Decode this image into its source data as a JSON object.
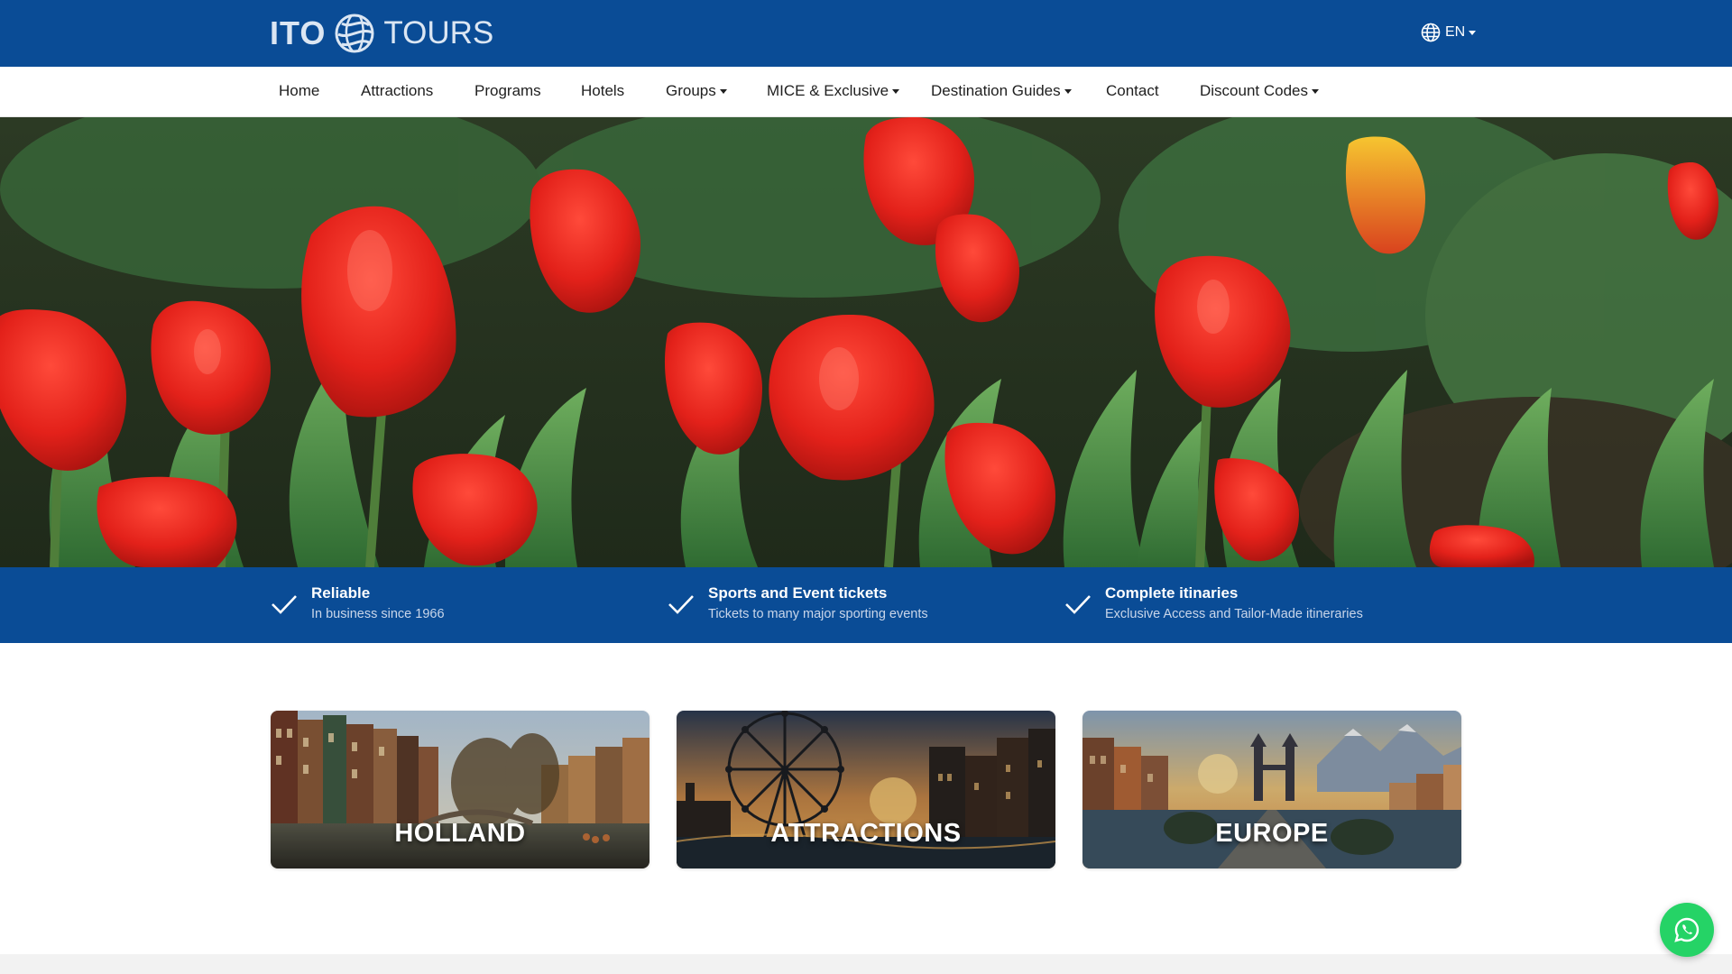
{
  "brand": {
    "name_left": "ITO",
    "name_right": "TOURS"
  },
  "language": {
    "code": "EN",
    "icon": "globe-icon"
  },
  "nav": {
    "items": [
      {
        "label": "Home",
        "dropdown": false
      },
      {
        "label": "Attractions",
        "dropdown": false
      },
      {
        "label": "Programs",
        "dropdown": false
      },
      {
        "label": "Hotels",
        "dropdown": false
      },
      {
        "label": "Groups",
        "dropdown": true
      },
      {
        "label": "MICE & Exclusive",
        "dropdown": true
      },
      {
        "label": "Destination Guides",
        "dropdown": true
      },
      {
        "label": "Contact",
        "dropdown": false
      },
      {
        "label": "Discount Codes",
        "dropdown": true
      }
    ]
  },
  "hero": {
    "image": "red-tulips-photo"
  },
  "features": [
    {
      "title": "Reliable",
      "subtitle": "In business since 1966",
      "icon": "check-icon"
    },
    {
      "title": "Sports and Event tickets",
      "subtitle": "Tickets to many major sporting events",
      "icon": "check-icon"
    },
    {
      "title": "Complete itinaries",
      "subtitle": "Exclusive Access and Tailor-Made itineraries",
      "icon": "check-icon"
    }
  ],
  "cards": [
    {
      "label": "HOLLAND",
      "image": "amsterdam-canal-photo"
    },
    {
      "label": "ATTRACTIONS",
      "image": "london-eye-photo"
    },
    {
      "label": "EUROPE",
      "image": "europe-collage-photo"
    }
  ],
  "colors": {
    "brand_blue": "#0a4c96",
    "whatsapp_green": "#25d366",
    "tulip_red": "#e0241b"
  },
  "whatsapp": {
    "icon": "whatsapp-icon"
  }
}
